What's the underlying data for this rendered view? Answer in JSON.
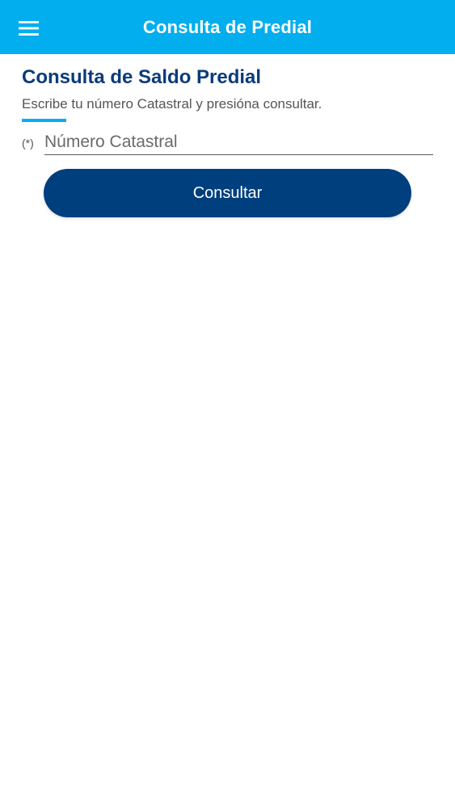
{
  "colors": {
    "appbar": "#03aeef",
    "title": "#0b3b7a",
    "button": "#003f7e",
    "accent": "#03aeef"
  },
  "header": {
    "title": "Consulta de Predial",
    "menu_icon": "hamburger-menu-icon"
  },
  "main": {
    "title": "Consulta de Saldo Predial",
    "subtitle": "Escribe tu número Catastral y presióna consultar.",
    "field": {
      "required_mark": "(*)",
      "placeholder": "Número Catastral",
      "value": ""
    },
    "submit_label": "Consultar"
  }
}
